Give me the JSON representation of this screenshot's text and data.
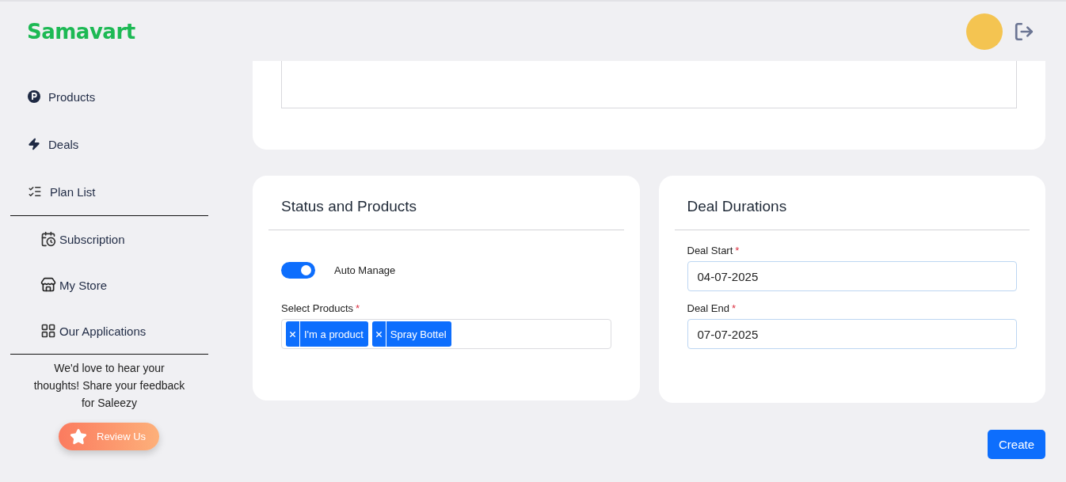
{
  "header": {
    "logo": "Samavart"
  },
  "sidebar": {
    "primary": [
      {
        "label": "Products"
      },
      {
        "label": "Deals"
      },
      {
        "label": "Plan List"
      }
    ],
    "secondary": [
      {
        "label": "Subscription"
      },
      {
        "label": "My Store"
      },
      {
        "label": "Our Applications"
      }
    ],
    "feedback": "We'd love to hear your thoughts! Share your feedback for Saleezy",
    "review_button": "Review Us"
  },
  "status_card": {
    "title": "Status and Products",
    "toggle": {
      "label": "Auto Manage",
      "on": true
    },
    "products_field": {
      "label": "Select Products",
      "required_mark": "*",
      "chips": [
        {
          "label": "I'm a product"
        },
        {
          "label": "Spray Bottel"
        }
      ]
    }
  },
  "duration_card": {
    "title": "Deal Durations",
    "fields": [
      {
        "label": "Deal Start",
        "required_mark": "*",
        "value": "04-07-2025"
      },
      {
        "label": "Deal End",
        "required_mark": "*",
        "value": "07-07-2025"
      }
    ]
  },
  "create_button": "Create"
}
